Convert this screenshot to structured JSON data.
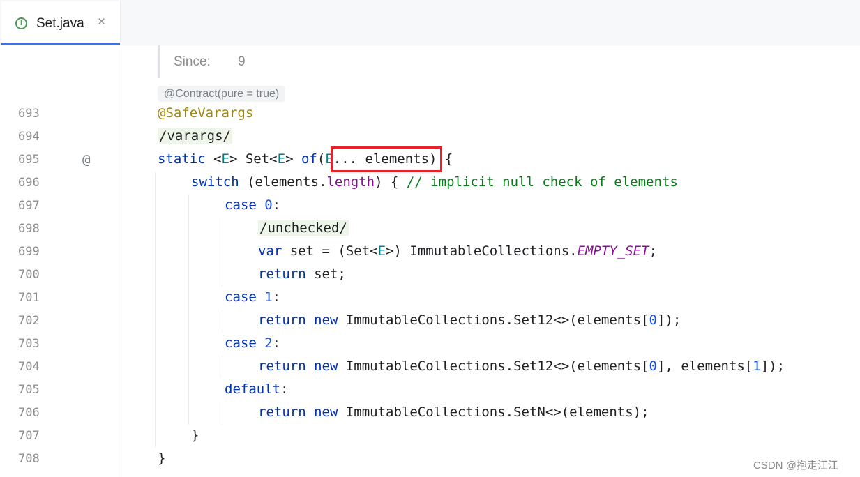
{
  "tab": {
    "title": "Set.java",
    "icon_letter": "I",
    "icon": "interface-icon",
    "close_glyph": "×"
  },
  "doc": {
    "since_label": "Since:",
    "since_value": "9"
  },
  "contract_hint": "@Contract(pure = true)",
  "gutter": {
    "line_numbers": [
      "693",
      "694",
      "695",
      "696",
      "697",
      "698",
      "699",
      "700",
      "701",
      "702",
      "703",
      "704",
      "705",
      "706",
      "707",
      "708"
    ],
    "at_glyph": "@"
  },
  "code": {
    "l693": {
      "ann": "@SafeVarargs"
    },
    "l694": {
      "hint": "/varargs/"
    },
    "l695": {
      "t1": "static",
      "t2": " <",
      "t3": "E",
      "t4": "> Set<",
      "t5": "E",
      "t6": "> ",
      "t7": "of",
      "t8": "(",
      "t9": "E",
      "t10": "... elements) {"
    },
    "l696": {
      "t1": "switch",
      "t2": " (elements.",
      "t3": "length",
      "t4": ") { ",
      "t5": "// implicit null check of elements"
    },
    "l697": {
      "t1": "case",
      "t2": " ",
      "t3": "0",
      "t4": ":"
    },
    "l698": {
      "hint": "/unchecked/"
    },
    "l699": {
      "t1": "var",
      "t2": " set = (Set<",
      "t3": "E",
      "t4": ">) ImmutableCollections.",
      "t5": "EMPTY_SET",
      "t6": ";"
    },
    "l700": {
      "t1": "return",
      "t2": " set;"
    },
    "l701": {
      "t1": "case",
      "t2": " ",
      "t3": "1",
      "t4": ":"
    },
    "l702": {
      "t1": "return",
      "t2": " ",
      "t3": "new",
      "t4": " ImmutableCollections.Set12<>(elements[",
      "t5": "0",
      "t6": "]);"
    },
    "l703": {
      "t1": "case",
      "t2": " ",
      "t3": "2",
      "t4": ":"
    },
    "l704": {
      "t1": "return",
      "t2": " ",
      "t3": "new",
      "t4": " ImmutableCollections.Set12<>(elements[",
      "t5": "0",
      "t6": "], elements[",
      "t7": "1",
      "t8": "]);"
    },
    "l705": {
      "t1": "default",
      "t2": ":"
    },
    "l706": {
      "t1": "return",
      "t2": " ",
      "t3": "new",
      "t4": " ImmutableCollections.SetN<>(elements);"
    },
    "l707": {
      "t1": "}"
    },
    "l708": {
      "t1": "}"
    }
  },
  "watermark": "CSDN @抱走江江",
  "colors": {
    "keyword": "#0033b3",
    "type_param": "#007e8a",
    "field": "#871094",
    "number": "#1750eb",
    "comment": "#067d17",
    "annotation": "#9e880d",
    "highlight_box": "#e3232b",
    "tab_accent": "#3574f0"
  }
}
